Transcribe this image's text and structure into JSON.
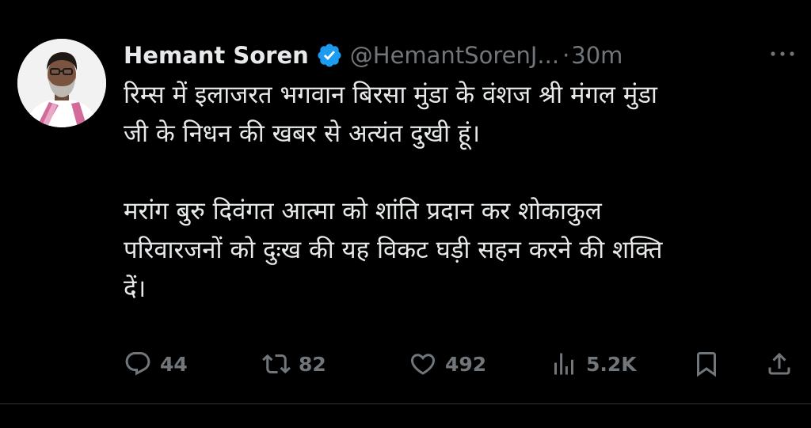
{
  "tweet": {
    "author": {
      "display_name": "Hemant Soren",
      "handle": "@HemantSorenJ...",
      "verified": true,
      "verified_color": "#1d9bf0"
    },
    "separator": "·",
    "time": "30m",
    "text": "रिम्स में इलाजरत भगवान बिरसा मुंडा के वंशज श्री मंगल मुंडा\nजी के निधन की खबर से अत्यंत दुखी हूं।\n\nमरांग बुरु दिवंगत आत्मा को शांति प्रदान कर शोकाकुल\nपरिवारजनों को दुःख की यह विकट घड़ी सहन करने की शक्ति\nदें।",
    "stats": {
      "replies": "44",
      "retweets": "82",
      "likes": "492",
      "views": "5.2K"
    }
  },
  "icons": {
    "more": "more-horizontal-icon",
    "reply": "reply-icon",
    "retweet": "retweet-icon",
    "like": "heart-icon",
    "views": "views-chart-icon",
    "bookmark": "bookmark-icon",
    "share": "share-icon"
  },
  "colors": {
    "background": "#000000",
    "primary_text": "#e7e9ea",
    "secondary_text": "#71767b",
    "verified_blue": "#1d9bf0"
  }
}
